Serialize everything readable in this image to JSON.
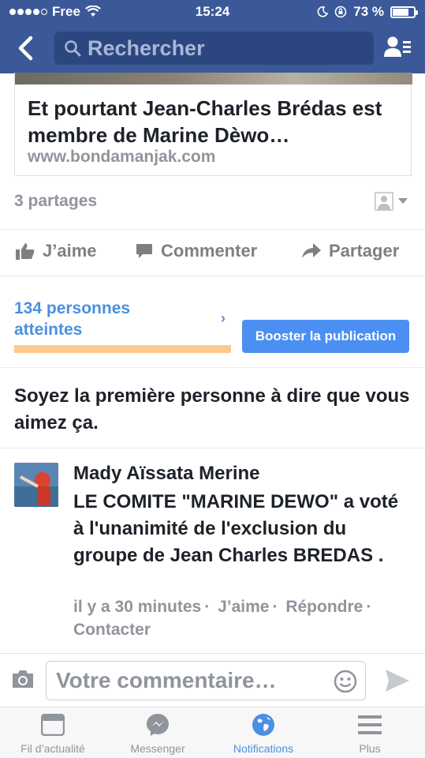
{
  "status_bar": {
    "carrier": "Free",
    "time": "15:24",
    "battery": "73 %"
  },
  "header": {
    "search_placeholder": "Rechercher"
  },
  "link_card": {
    "title": "Et pourtant Jean-Charles Brédas est membre de Marine Dèwo…",
    "url": "www.bondamanjak.com"
  },
  "post": {
    "shares": "3 partages",
    "actions": {
      "like": "J’aime",
      "comment": "Commenter",
      "share": "Partager"
    }
  },
  "reach": {
    "count_text": "134 personnes atteintes",
    "boost_label": "Booster la publication"
  },
  "likes_prompt": "Soyez la première personne à dire que vous aimez ça.",
  "comment": {
    "author": "Mady Aïssata Merine",
    "text": "LE COMITE \"MARINE DEWO\" a voté à l'unanimité de l'exclusion du groupe de Jean Charles BREDAS .",
    "time": "il y a 30 minutes",
    "like": "J’aime",
    "reply": "Répondre",
    "contact": "Contacter"
  },
  "composer": {
    "placeholder": "Votre commentaire…"
  },
  "tab_bar": [
    {
      "label": "Fil d’actualité",
      "icon": "news-feed-icon"
    },
    {
      "label": "Messenger",
      "icon": "messenger-icon"
    },
    {
      "label": "Notifications",
      "icon": "globe-icon"
    },
    {
      "label": "Plus",
      "icon": "menu-icon"
    }
  ],
  "colors": {
    "brand": "#3b5998",
    "accent": "#4a90e2",
    "boost": "#4c8ff2",
    "reach_bar": "#fbc98e"
  }
}
